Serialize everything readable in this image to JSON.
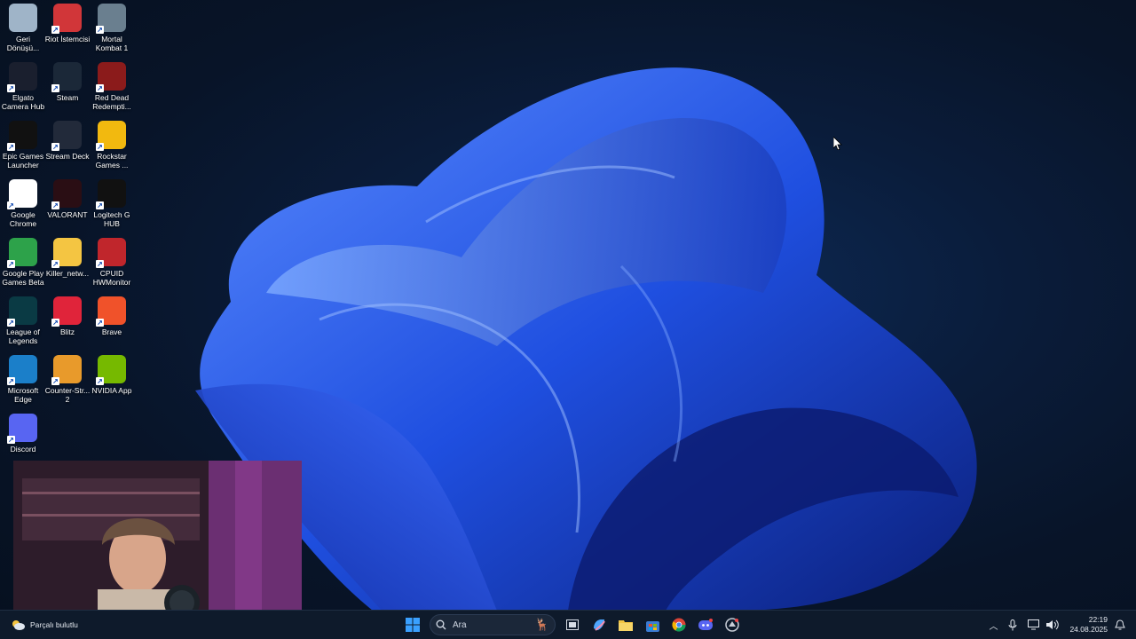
{
  "desktop": {
    "icons": [
      {
        "label": "Geri Dönüşü...",
        "icon": "recycle-bin-icon",
        "color": "#9fb4c8"
      },
      {
        "label": "Riot İstemcisi",
        "icon": "riot-client-icon",
        "color": "#d13639"
      },
      {
        "label": "Mortal Kombat 1",
        "icon": "mortal-kombat-icon",
        "color": "#6a7f8f"
      },
      {
        "label": "Elgato Camera Hub",
        "icon": "elgato-icon",
        "color": "#1a1f2e"
      },
      {
        "label": "Steam",
        "icon": "steam-icon",
        "color": "#1b2838"
      },
      {
        "label": "Red Dead Redempti...",
        "icon": "red-dead-icon",
        "color": "#8b1b1b"
      },
      {
        "label": "Epic Games Launcher",
        "icon": "epic-games-icon",
        "color": "#111111"
      },
      {
        "label": "Stream Deck",
        "icon": "stream-deck-icon",
        "color": "#222a3a"
      },
      {
        "label": "Rockstar Games ...",
        "icon": "rockstar-icon",
        "color": "#f2b90f"
      },
      {
        "label": "Google Chrome",
        "icon": "chrome-icon",
        "color": "#ffffff"
      },
      {
        "label": "VALORANT",
        "icon": "valorant-icon",
        "color": "#2a0e14"
      },
      {
        "label": "Logitech G HUB",
        "icon": "logitech-icon",
        "color": "#111111"
      },
      {
        "label": "Google Play Games Beta",
        "icon": "play-games-icon",
        "color": "#2da24a"
      },
      {
        "label": "Killer_netw...",
        "icon": "folder-icon",
        "color": "#f4c542"
      },
      {
        "label": "CPUID HWMonitor",
        "icon": "hwmonitor-icon",
        "color": "#c0262c"
      },
      {
        "label": "League of Legends",
        "icon": "league-icon",
        "color": "#0a3a44"
      },
      {
        "label": "Blitz",
        "icon": "blitz-icon",
        "color": "#e0243a"
      },
      {
        "label": "Brave",
        "icon": "brave-icon",
        "color": "#f0522a"
      },
      {
        "label": "Microsoft Edge",
        "icon": "edge-icon",
        "color": "#1b7fc9"
      },
      {
        "label": "Counter-Str... 2",
        "icon": "cs2-icon",
        "color": "#e89a2b"
      },
      {
        "label": "NVIDIA App",
        "icon": "nvidia-icon",
        "color": "#76b900"
      },
      {
        "label": "Discord",
        "icon": "discord-icon",
        "color": "#5865f2"
      }
    ]
  },
  "taskbar": {
    "weather_text": "Parçalı bulutlu",
    "search_placeholder": "Ara",
    "clock_time": "22:19",
    "clock_date": "24.08.2025",
    "accent": "#0a74da"
  }
}
